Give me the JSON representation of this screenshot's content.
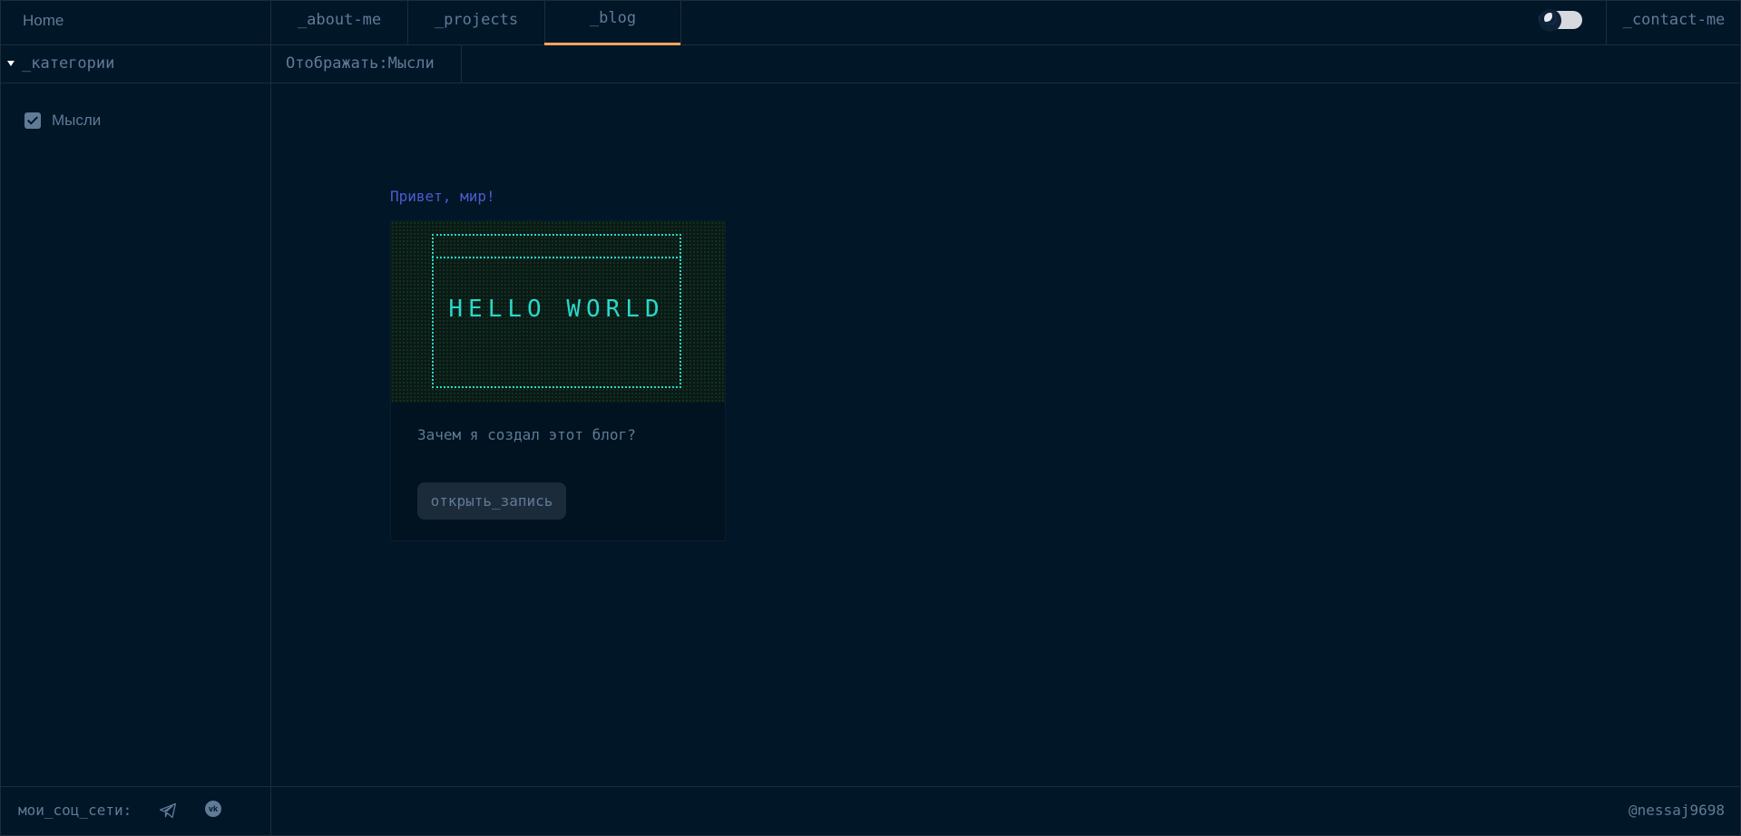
{
  "header": {
    "home": "Home",
    "tabs": [
      {
        "label": "_about-me"
      },
      {
        "label": "_projects"
      },
      {
        "label": "_blog"
      }
    ],
    "contact": "_contact-me"
  },
  "sidebar": {
    "section_title": "_категории",
    "categories": [
      {
        "label": "Мысли",
        "checked": true
      }
    ]
  },
  "filter": {
    "label": "Отображать:Мысли"
  },
  "posts": [
    {
      "title": "Привет, мир!",
      "cover_text": "HELLO WORLD",
      "description": "Зачем я создал этот блог?",
      "button_label": "открыть_запись"
    }
  ],
  "footer": {
    "social_label": "мои_соц_сети:",
    "social_icons": [
      "telegram-icon",
      "vk-icon"
    ],
    "vk_glyph": "vk",
    "handle": "@nessaj9698"
  },
  "colors": {
    "background": "#011627",
    "border": "#1e2d3d",
    "text": "#607b96",
    "accent": "#fea55f",
    "title": "#4d5bce",
    "cover": "#2bd7c9"
  }
}
